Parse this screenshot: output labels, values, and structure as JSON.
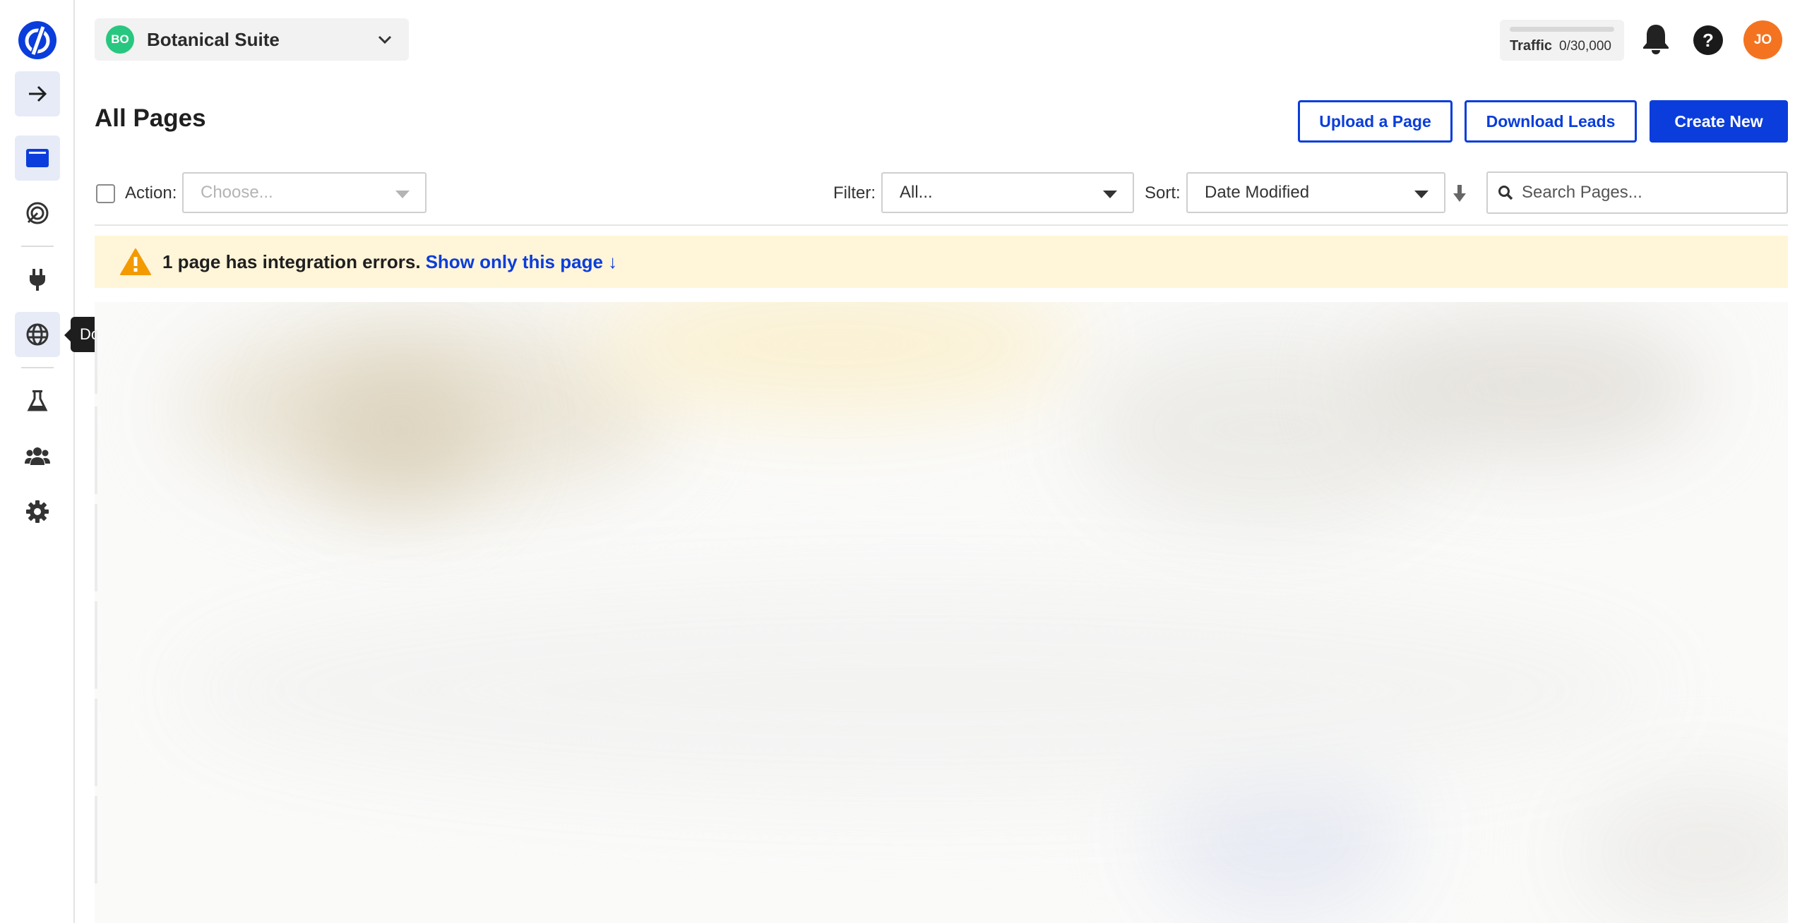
{
  "sidebar": {
    "items": [
      {
        "name": "arrow-right-icon"
      },
      {
        "name": "pages-icon"
      },
      {
        "name": "target-icon"
      },
      {
        "name": "plug-icon"
      },
      {
        "name": "globe-icon"
      },
      {
        "name": "flask-icon"
      },
      {
        "name": "users-icon"
      },
      {
        "name": "gear-icon"
      }
    ],
    "tooltip": "Do"
  },
  "header": {
    "workspace": {
      "badge": "BO",
      "name": "Botanical Suite"
    },
    "traffic": {
      "label": "Traffic",
      "value": "0/30,000",
      "fraction": 0.0
    },
    "avatar": "JO"
  },
  "page": {
    "title": "All Pages",
    "buttons": {
      "upload": "Upload a Page",
      "download": "Download Leads",
      "create": "Create New"
    }
  },
  "toolbar": {
    "action_label": "Action:",
    "action_placeholder": "Choose...",
    "filter_label": "Filter:",
    "filter_value": "All...",
    "sort_label": "Sort:",
    "sort_value": "Date Modified",
    "search_placeholder": "Search Pages..."
  },
  "alert": {
    "message": "1 page has integration errors.",
    "link": "Show only this page ↓"
  },
  "colors": {
    "brand": "#0a3ddb",
    "alert_bg": "#fff5d9",
    "workspace_badge": "#27c77f",
    "avatar": "#f47321"
  }
}
